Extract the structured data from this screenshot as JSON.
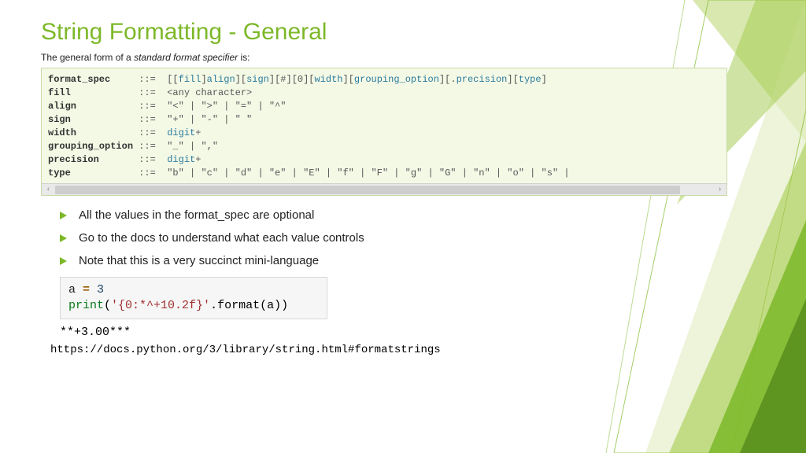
{
  "title": "String Formatting - General",
  "subtitle_pre": "The general form of a ",
  "subtitle_em": "standard format specifier",
  "subtitle_post": " is:",
  "grammar": {
    "rows": [
      {
        "name": "format_spec",
        "rhs_html": "[[<span class='tok'>fill</span>]<span class='tok'>align</span>][<span class='tok'>sign</span>][#][0][<span class='tok'>width</span>][<span class='tok'>grouping_option</span>][.<span class='tok'>precision</span>][<span class='tok'>type</span>]"
      },
      {
        "name": "fill",
        "rhs_html": "&lt;any character&gt;"
      },
      {
        "name": "align",
        "rhs_html": "\"&lt;\" | \"&gt;\" | \"=\" | \"^\""
      },
      {
        "name": "sign",
        "rhs_html": "\"+\" | \"-\" | \" \""
      },
      {
        "name": "width",
        "rhs_html": "<span class='tok'>digit</span>+"
      },
      {
        "name": "grouping_option",
        "rhs_html": "\"_\" | \",\""
      },
      {
        "name": "precision",
        "rhs_html": "<span class='tok'>digit</span>+"
      },
      {
        "name": "type",
        "rhs_html": "\"b\" | \"c\" | \"d\" | \"e\" | \"E\" | \"f\" | \"F\" | \"g\" | \"G\" | \"n\" | \"o\" | \"s\" |"
      }
    ]
  },
  "bullets": [
    "All the values in the format_spec are optional",
    "Go to the docs to understand what each value controls",
    "Note that this is a very succinct mini-language"
  ],
  "code": {
    "line1_var": "a",
    "line1_op": " = ",
    "line1_num": "3",
    "line2_fn": "print",
    "line2_open": "(",
    "line2_str": "'{0:*^+10.2f}'",
    "line2_method": ".format(a))"
  },
  "output": "**+3.00***",
  "url": "https://docs.python.org/3/library/string.html#formatstrings"
}
